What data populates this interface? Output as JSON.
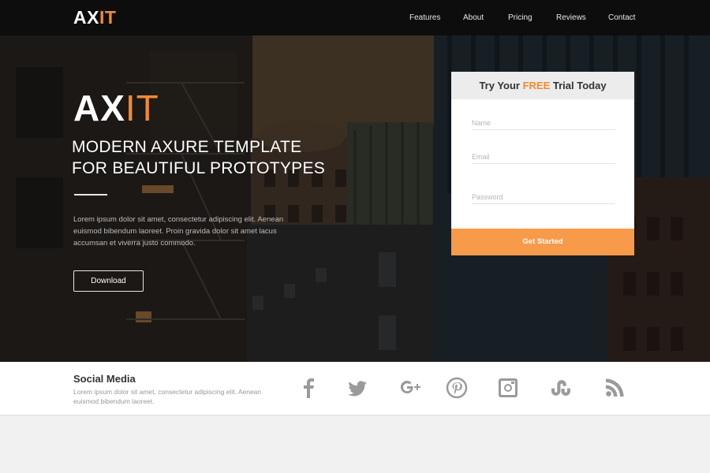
{
  "header": {
    "logo_ax": "AX",
    "logo_it": "IT",
    "nav": [
      "Features",
      "About",
      "Pricing",
      "Reviews",
      "Contact"
    ]
  },
  "hero": {
    "logo_ax": "AX",
    "logo_it": "IT",
    "title_line1": "MODERN AXURE TEMPLATE",
    "title_line2": "FOR BEAUTIFUL PROTOTYPES",
    "body": "Lorem ipsum dolor sit amet, consectetur adipiscing elit. Aenean euismod bibendum laoreet. Proin gravida dolor sit amet lacus accumsan et viverra justo commodo.",
    "download_label": "Download"
  },
  "trial": {
    "title_pre": "Try Your ",
    "title_free": "FREE",
    "title_post": " Trial Today",
    "name_placeholder": "Name",
    "email_placeholder": "Email",
    "password_placeholder": "Password",
    "submit_label": "Get Started"
  },
  "social": {
    "title": "Social Media",
    "text": "Lorem ipsum dolor sit amet, consectetur adipiscing elit. Aenean euismod bibendum laoreet.",
    "icons": [
      "facebook-icon",
      "twitter-icon",
      "google-plus-icon",
      "pinterest-icon",
      "instagram-icon",
      "stumbleupon-icon",
      "rss-icon"
    ]
  },
  "colors": {
    "accent": "#f28a32",
    "button_orange": "#f79a4a",
    "topbar": "#0d0d0d",
    "social_icon": "#9a9a9a"
  }
}
